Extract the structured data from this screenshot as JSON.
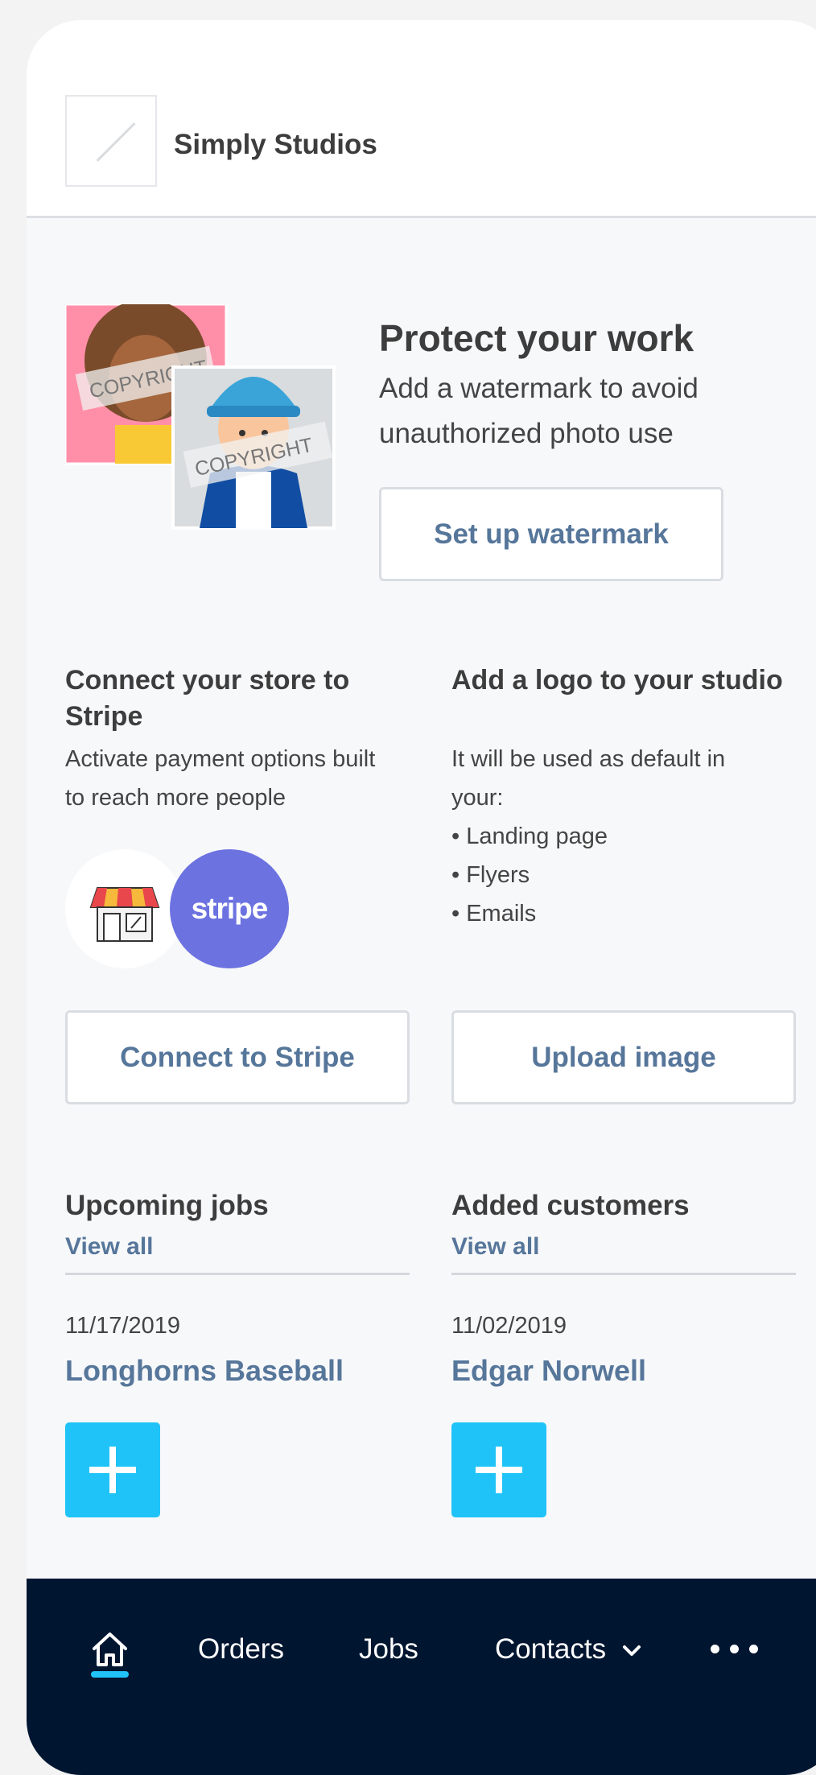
{
  "header": {
    "studio_name": "Simply Studios"
  },
  "watermark_promo": {
    "stamp_text": "COPYRIGHT",
    "title": "Protect your work",
    "description": "Add a watermark to avoid unauthorized photo use",
    "button_label": "Set up watermark"
  },
  "stripe_card": {
    "title": "Connect your store to Stripe",
    "description": "Activate payment options built to reach more people",
    "stripe_logo_text": "stripe",
    "button_label": "Connect to Stripe"
  },
  "logo_card": {
    "title": "Add a logo to your studio",
    "description": "It will be used as default in your:",
    "bullets": [
      "• Landing page",
      "• Flyers",
      "• Emails"
    ],
    "button_label": "Upload image"
  },
  "upcoming_jobs": {
    "title": "Upcoming jobs",
    "view_all": "View all",
    "date": "11/17/2019",
    "name": "Longhorns Baseball"
  },
  "added_customers": {
    "title": "Added customers",
    "view_all": "View all",
    "date": "11/02/2019",
    "name": "Edgar Norwell"
  },
  "nav": {
    "home_icon": "home-icon",
    "orders": "Orders",
    "jobs": "Jobs",
    "contacts": "Contacts",
    "more_icon": "more-icon"
  },
  "colors": {
    "accent": "#20c3f7",
    "link": "#56769a",
    "nav_bg": "#001530",
    "stripe": "#6c72e0"
  }
}
